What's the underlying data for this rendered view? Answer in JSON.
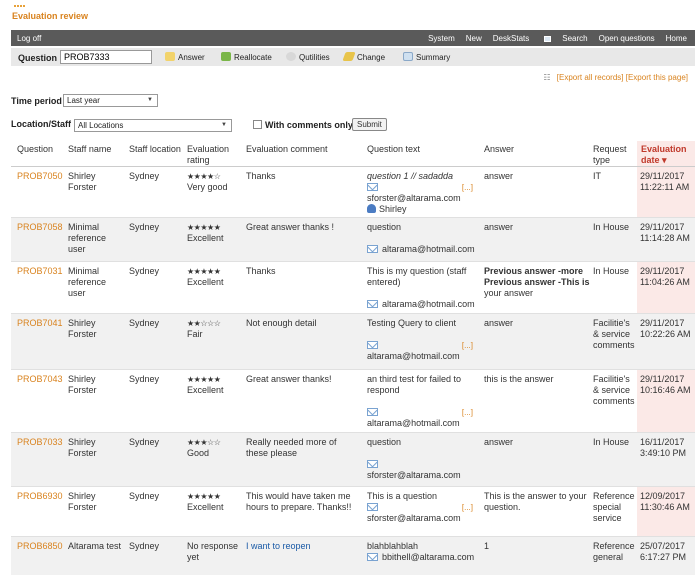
{
  "app": {
    "title": "Evaluation review"
  },
  "nav": {
    "logoff": "Log off",
    "items": [
      "System",
      "New",
      "DeskStats",
      "Search",
      "Open questions",
      "Home"
    ]
  },
  "question_bar": {
    "label": "Question",
    "value": "PROB7333",
    "tools": [
      "Answer",
      "Reallocate",
      "Qutilities",
      "Change",
      "Summary"
    ]
  },
  "export": {
    "all": "[Export all records]",
    "page": "[Export this page]"
  },
  "filters": {
    "time_period_label": "Time period",
    "time_period_value": "Last year",
    "location_label": "Location/Staff",
    "location_value": "All Locations",
    "comments_label": "With comments only",
    "submit_label": "Submit"
  },
  "table": {
    "headers": {
      "question": "Question",
      "staff_name": "Staff name",
      "staff_location": "Staff location",
      "rating": "Evaluation rating",
      "comment": "Evaluation comment",
      "question_text": "Question text",
      "answer": "Answer",
      "request_type": "Request type",
      "date": "Evaluation date",
      "sort_indicator": "▾"
    },
    "more_label": "[...]",
    "rows": [
      {
        "id": "PROB7050",
        "staff": "Shirley Forster",
        "location": "Sydney",
        "stars": "★★★★☆",
        "rating": "Very good",
        "comment": "Thanks",
        "qtext": "question 1 // sadadda",
        "email": "sforster@altarama.com",
        "person": "Shirley",
        "answer": "answer",
        "rtype": "IT",
        "date": "29/11/2017 11:22:11 AM"
      },
      {
        "id": "PROB7058",
        "staff": "Minimal reference user",
        "location": "Sydney",
        "stars": "★★★★★",
        "rating": "Excellent",
        "comment": "Great answer thanks !",
        "qtext": "question",
        "email": "altarama@hotmail.com",
        "answer": "answer",
        "rtype": "In House",
        "date": "29/11/2017 11:14:28 AM"
      },
      {
        "id": "PROB7031",
        "staff": "Minimal reference user",
        "location": "Sydney",
        "stars": "★★★★★",
        "rating": "Excellent",
        "comment": "Thanks",
        "qtext": "This is my question (staff entered)",
        "email": "altarama@hotmail.com",
        "answer_bold1": "Previous answer -more",
        "answer_bold2": "Previous answer -This is",
        "answer": "your answer",
        "rtype": "In House",
        "date": "29/11/2017 11:04:26 AM"
      },
      {
        "id": "PROB7041",
        "staff": "Shirley Forster",
        "location": "Sydney",
        "stars": "★★☆☆☆",
        "rating": "Fair",
        "comment": "Not enough detail",
        "qtext": "Testing Query to client",
        "email": "altarama@hotmail.com",
        "answer": "answer",
        "rtype": "Facilitie's & service comments",
        "date": "29/11/2017 10:22:26 AM"
      },
      {
        "id": "PROB7043",
        "staff": "Shirley Forster",
        "location": "Sydney",
        "stars": "★★★★★",
        "rating": "Excellent",
        "comment": "Great answer thanks!",
        "qtext": "an third test for failed to respond",
        "email": "altarama@hotmail.com",
        "answer": "this is the answer",
        "rtype": "Facilitie's & service comments",
        "date": "29/11/2017 10:16:46 AM"
      },
      {
        "id": "PROB7033",
        "staff": "Shirley Forster",
        "location": "Sydney",
        "stars": "★★★☆☆",
        "rating": "Good",
        "comment": "Really needed more of these please",
        "qtext": "question",
        "email": "sforster@altarama.com",
        "answer": "answer",
        "rtype": "In House",
        "date": "16/11/2017 3:49:10 PM"
      },
      {
        "id": "PROB6930",
        "staff": "Shirley Forster",
        "location": "Sydney",
        "stars": "★★★★★",
        "rating": "Excellent",
        "comment": "This would have taken me hours to prepare. Thanks!!",
        "qtext": "This is a question",
        "email": "sforster@altarama.com",
        "answer": "This is the answer to your question.",
        "rtype": "Reference special service",
        "date": "12/09/2017 11:30:46 AM"
      },
      {
        "id": "PROB6850",
        "staff": "Altarama test",
        "location": "Sydney",
        "rating": "No response yet",
        "comment": "I want to reopen",
        "qtext": "blahblahblah",
        "email": "bbithell@altarama.com",
        "answer": "1",
        "rtype": "Reference general",
        "date": "25/07/2017 6:17:27 PM"
      }
    ]
  },
  "colors": {
    "accent": "#d9831f",
    "nav_bg": "#5a5a5a",
    "sorted_header": "#c0392b",
    "sorted_column_bg": "#fbe9e7",
    "link_blue": "#1a5aa6"
  }
}
